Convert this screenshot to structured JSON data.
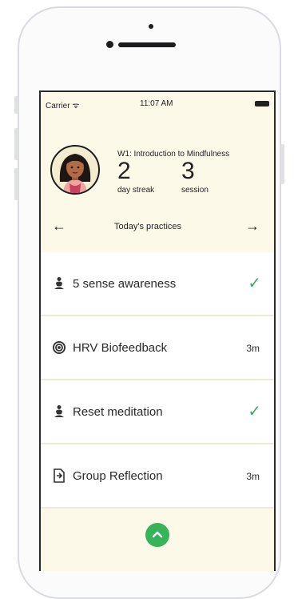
{
  "status_bar": {
    "carrier": "Carrier ᯤ",
    "time": "11:07 AM"
  },
  "header": {
    "week_title": "W1: Introduction to Mindfulness",
    "day_streak": {
      "value": "2",
      "label": "day streak"
    },
    "session": {
      "value": "3",
      "label": "session"
    },
    "nav_left_icon": "arrow-left-icon",
    "nav_right_icon": "arrow-right-icon",
    "practices_title": "Today's practices"
  },
  "practices": [
    {
      "label": "5 sense awareness",
      "icon": "meditation-icon",
      "status": "completed"
    },
    {
      "label": "HRV Biofeedback",
      "icon": "biofeedback-icon",
      "duration": "3m"
    },
    {
      "label": "Reset meditation",
      "icon": "meditation-icon",
      "status": "completed"
    },
    {
      "label": "Group Reflection",
      "icon": "reflection-icon",
      "duration": "3m"
    }
  ],
  "colors": {
    "screen_bg": "#fcf9e9",
    "check": "#3cae5f",
    "fab": "#35b45a",
    "row_bg": "#ffffff"
  },
  "fab_icon": "chevron-up-icon"
}
